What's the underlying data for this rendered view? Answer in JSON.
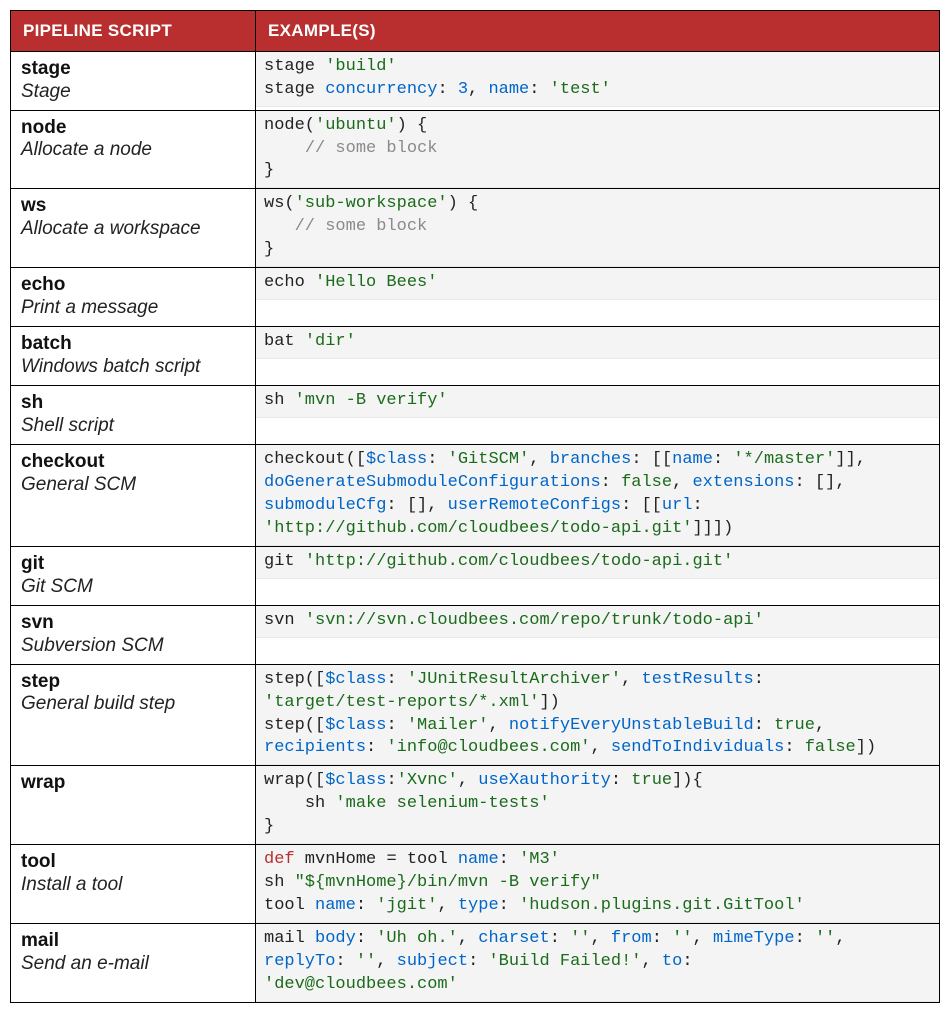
{
  "headers": {
    "col1": "PIPELINE SCRIPT",
    "col2": "EXAMPLE(S)"
  },
  "rows": [
    {
      "name": "stage",
      "desc": "Stage",
      "code_html": "stage <span class='s'>'build'</span>\nstage <span class='p'>concurrency</span>: <span class='n'>3</span>, <span class='p'>name</span>: <span class='s'>'test'</span>",
      "code_plain": "stage 'build'\nstage concurrency: 3, name: 'test'",
      "has_spacer": false
    },
    {
      "name": "node",
      "desc": "Allocate a node",
      "code_html": "node(<span class='s'>'ubuntu'</span>) {\n    <span class='c'>// some block</span>\n}",
      "code_plain": "node('ubuntu') {\n    // some block\n}",
      "has_spacer": false
    },
    {
      "name": "ws",
      "desc": "Allocate a workspace",
      "code_html": "ws(<span class='s'>'sub-workspace'</span>) {\n   <span class='c'>// some block</span>\n}",
      "code_plain": "ws('sub-workspace') {\n   // some block\n}",
      "has_spacer": false
    },
    {
      "name": "echo",
      "desc": "Print a message",
      "code_html": "echo <span class='s'>'Hello Bees'</span>",
      "code_plain": "echo 'Hello Bees'",
      "has_spacer": true
    },
    {
      "name": "batch",
      "desc": "Windows batch script",
      "code_html": "bat <span class='s'>'dir'</span>",
      "code_plain": "bat 'dir'",
      "has_spacer": true
    },
    {
      "name": "sh",
      "desc": "Shell script",
      "code_html": "sh <span class='s'>'mvn -B verify'</span>",
      "code_plain": "sh 'mvn -B verify'",
      "has_spacer": true
    },
    {
      "name": "checkout",
      "desc": "General SCM",
      "code_html": "checkout([<span class='p'>$class</span>: <span class='s'>'GitSCM'</span>, <span class='p'>branches</span>: [[<span class='p'>name</span>: <span class='s'>'*/master'</span>]],\n<span class='p'>doGenerateSubmoduleConfigurations</span>: <span class='v'>false</span>, <span class='p'>extensions</span>: [],\n<span class='p'>submoduleCfg</span>: [], <span class='p'>userRemoteConfigs</span>: [[<span class='p'>url</span>:\n<span class='s'>'http://github.com/cloudbees/todo-api.git'</span>]]])",
      "code_plain": "checkout([$class: 'GitSCM', branches: [[name: '*/master']],\ndoGenerateSubmoduleConfigurations: false, extensions: [],\nsubmoduleCfg: [], userRemoteConfigs: [[url:\n'http://github.com/cloudbees/todo-api.git']]])",
      "has_spacer": false
    },
    {
      "name": "git",
      "desc": "Git SCM",
      "code_html": "git <span class='s'>'http://github.com/cloudbees/todo-api.git'</span>",
      "code_plain": "git 'http://github.com/cloudbees/todo-api.git'",
      "has_spacer": true
    },
    {
      "name": "svn",
      "desc": "Subversion SCM",
      "code_html": "svn <span class='s'>'svn://svn.cloudbees.com/repo/trunk/todo-api'</span>",
      "code_plain": "svn 'svn://svn.cloudbees.com/repo/trunk/todo-api'",
      "has_spacer": true
    },
    {
      "name": "step",
      "desc": "General build step",
      "code_html": "step([<span class='p'>$class</span>: <span class='s'>'JUnitResultArchiver'</span>, <span class='p'>testResults</span>:\n<span class='s'>'target/test-reports/*.xml'</span>])\nstep([<span class='p'>$class</span>: <span class='s'>'Mailer'</span>, <span class='p'>notifyEveryUnstableBuild</span>: <span class='v'>true</span>,\n<span class='p'>recipients</span>: <span class='s'>'info@cloudbees.com'</span>, <span class='p'>sendToIndividuals</span>: <span class='v'>false</span>])",
      "code_plain": "step([$class: 'JUnitResultArchiver', testResults:\n'target/test-reports/*.xml'])\nstep([$class: 'Mailer', notifyEveryUnstableBuild: true,\nrecipients: 'info@cloudbees.com', sendToIndividuals: false])",
      "has_spacer": false
    },
    {
      "name": "wrap",
      "desc": "",
      "code_html": "wrap([<span class='p'>$class</span>:<span class='s'>'Xvnc'</span>, <span class='p'>useXauthority</span>: <span class='v'>true</span>]){\n    sh <span class='s'>'make selenium-tests'</span>\n}",
      "code_plain": "wrap([$class:'Xvnc', useXauthority: true]){\n    sh 'make selenium-tests'\n}",
      "has_spacer": false
    },
    {
      "name": "tool",
      "desc": "Install a tool",
      "code_html": "<span class='d'>def</span> mvnHome <span class='op'>=</span> tool <span class='p'>name</span>: <span class='s'>'M3'</span>\nsh <span class='s'>\"${mvnHome}/bin/mvn -B verify\"</span>\ntool <span class='p'>name</span>: <span class='s'>'jgit'</span>, <span class='p'>type</span>: <span class='s'>'hudson.plugins.git.GitTool'</span>",
      "code_plain": "def mvnHome = tool name: 'M3'\nsh \"${mvnHome}/bin/mvn -B verify\"\ntool name: 'jgit', type: 'hudson.plugins.git.GitTool'",
      "has_spacer": false
    },
    {
      "name": "mail",
      "desc": "Send an e-mail",
      "code_html": "mail <span class='p'>body</span>: <span class='s'>'Uh oh.'</span>, <span class='p'>charset</span>: <span class='s'>''</span>, <span class='p'>from</span>: <span class='s'>''</span>, <span class='p'>mimeType</span>: <span class='s'>''</span>,\n<span class='p'>replyTo</span>: <span class='s'>''</span>, <span class='p'>subject</span>: <span class='s'>'Build Failed!'</span>, <span class='p'>to</span>:\n<span class='s'>'dev@cloudbees.com'</span>",
      "code_plain": "mail body: 'Uh oh.', charset: '', from: '', mimeType: '',\nreplyTo: '', subject: 'Build Failed!', to:\n'dev@cloudbees.com'",
      "has_spacer": false
    }
  ]
}
